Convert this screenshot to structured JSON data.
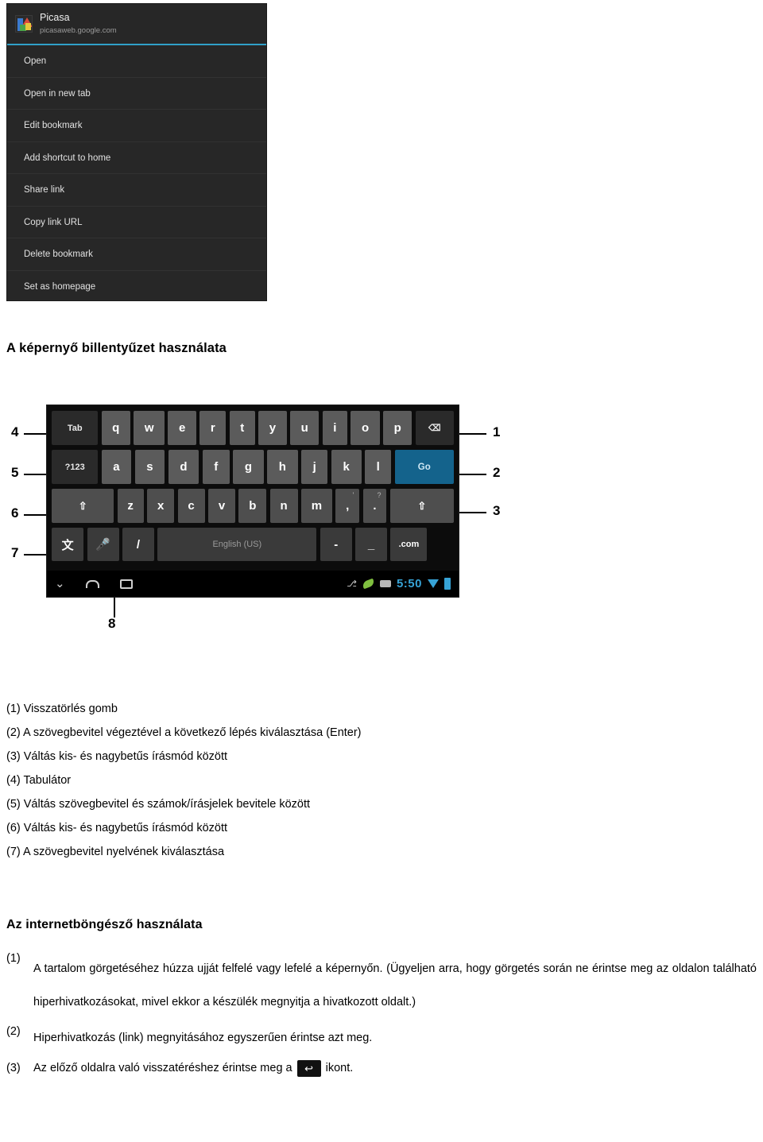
{
  "bookmark_menu": {
    "app_name": "Picasa",
    "app_url": "picasaweb.google.com",
    "accent_color": "#30a0c8",
    "items": [
      {
        "label": "Open"
      },
      {
        "label": "Open in new tab"
      },
      {
        "label": "Edit bookmark"
      },
      {
        "label": "Add shortcut to home"
      },
      {
        "label": "Share link"
      },
      {
        "label": "Copy link URL"
      },
      {
        "label": "Delete bookmark"
      },
      {
        "label": "Set as homepage"
      }
    ]
  },
  "sections": {
    "keyboard_heading": "A képernyő billentyűzet használata",
    "browser_heading": "Az internetböngésző használata"
  },
  "keyboard_figure": {
    "callouts": [
      "1",
      "2",
      "3",
      "4",
      "5",
      "6",
      "7",
      "8"
    ],
    "rows": {
      "row1": [
        "Tab",
        "q",
        "w",
        "e",
        "r",
        "t",
        "y",
        "u",
        "i",
        "o",
        "p",
        "⌫"
      ],
      "row2": [
        "?123",
        "a",
        "s",
        "d",
        "f",
        "g",
        "h",
        "j",
        "k",
        "l",
        "Go"
      ],
      "row3": [
        "⇧",
        "z",
        "x",
        "c",
        "v",
        "b",
        "n",
        "m",
        ",",
        ".",
        "⇧"
      ],
      "row3_sup": {
        "comma": "'",
        "period": "?"
      },
      "row4": [
        "文",
        "🎤",
        "/",
        "English (US)",
        "-",
        "_",
        ".com"
      ]
    },
    "space_label": "English (US)",
    "go_label": "Go",
    "tab_label": "Tab",
    "sym_label": "?123",
    "dotcom_label": ".com",
    "status_bar": {
      "time": "5:50",
      "time_color": "#37a3d6",
      "icons": [
        "usb-icon",
        "leaf-icon",
        "sdcard-icon",
        "wifi-icon",
        "battery-icon"
      ]
    }
  },
  "keyboard_legend": [
    "(1) Visszatörlés gomb",
    "(2) A szövegbevitel végeztével a következő lépés kiválasztása (Enter)",
    "(3) Váltás kis- és nagybetűs írásmód között",
    "(4) Tabulátor",
    "(5) Váltás szövegbevitel és számok/írásjelek bevitele között",
    "(6) Váltás kis- és nagybetűs írásmód között",
    "(7) A szövegbevitel nyelvének kiválasztása"
  ],
  "browser_list": {
    "item1_num": "(1)",
    "item1_text": "A tartalom görgetéséhez húzza ujját felfelé vagy lefelé a képernyőn. (Ügyeljen arra, hogy görgetés során ne érintse meg az oldalon található hiperhivatkozásokat, mivel ekkor a készülék megnyitja a hivatkozott oldalt.)",
    "item2_num": "(2)",
    "item2_text": "Hiperhivatkozás (link) megnyitásához egyszerűen érintse azt meg.",
    "item3_num": "(3)",
    "item3_text_before": "Az előző oldalra való visszatéréshez érintse meg a",
    "item3_icon": "back-icon",
    "item3_icon_glyph": "↩",
    "item3_text_after": "ikont."
  }
}
